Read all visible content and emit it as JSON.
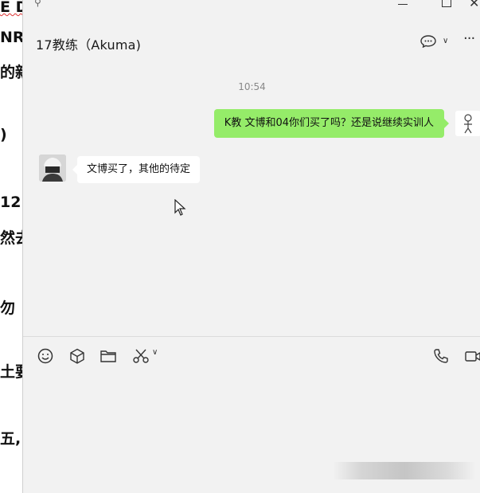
{
  "background_document": {
    "fragments": [
      "E D",
      "NR(",
      "的新",
      ")",
      "12",
      "然去",
      "勿",
      "土要",
      "五,"
    ]
  },
  "window": {
    "title": "17教练（Akuma)"
  },
  "messages": {
    "timestamp": "10:54",
    "sent_text": "K教 文博和04你们买了吗？还是说继续实训人",
    "received_text": "文博买了，其他的待定"
  },
  "icons": {
    "pin": "pin-icon",
    "minimize": "minimize-icon",
    "maximize": "maximize-icon",
    "close": "close-icon",
    "chat_bubble": "chat-bubble-icon",
    "menu": "menu-dots-icon",
    "emoji": "emoji-icon",
    "sticker": "cube-icon",
    "file": "folder-icon",
    "screenshot": "scissors-icon",
    "voice_call": "phone-icon",
    "video_call": "video-icon"
  },
  "colors": {
    "sent_bubble": "#95ec69",
    "received_bubble": "#ffffff",
    "window_bg": "#f2f2f2"
  }
}
